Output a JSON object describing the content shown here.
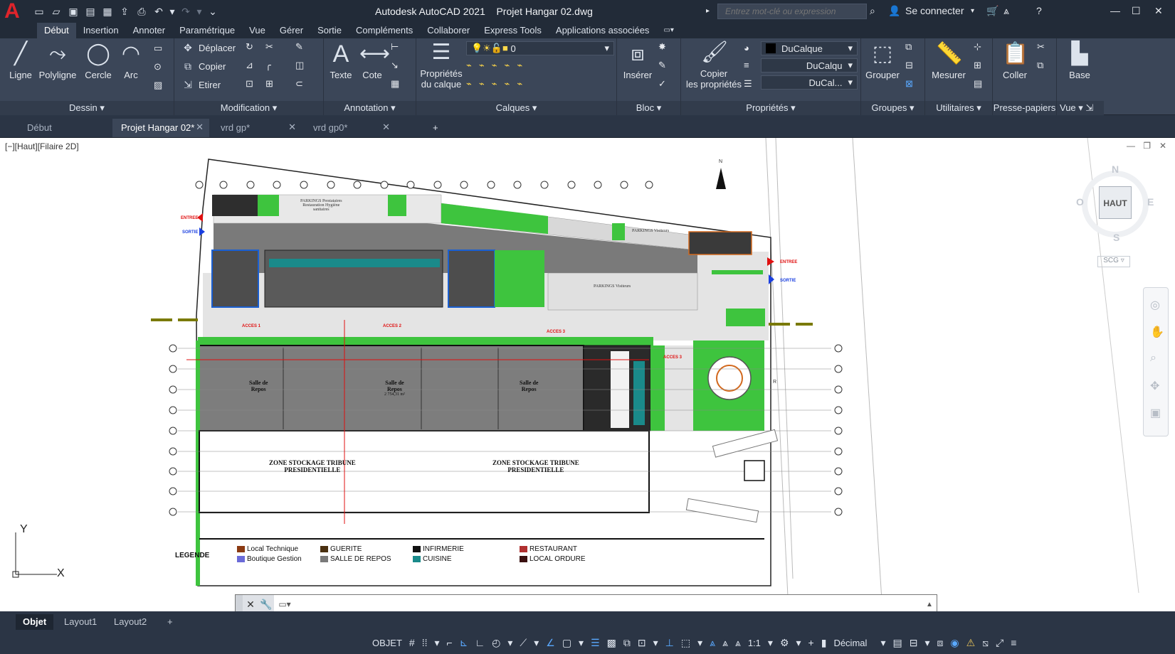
{
  "app": {
    "title": "Autodesk AutoCAD 2021",
    "file": "Projet Hangar 02.dwg",
    "search_placeholder": "Entrez mot-clé ou expression",
    "signin": "Se connecter",
    "logo_letter": "A"
  },
  "ribbon_tabs": [
    "Début",
    "Insertion",
    "Annoter",
    "Paramétrique",
    "Vue",
    "Gérer",
    "Sortie",
    "Compléments",
    "Collaborer",
    "Express Tools",
    "Applications associées"
  ],
  "ribbon": {
    "dessin": {
      "title": "Dessin",
      "ligne": "Ligne",
      "polyligne": "Polyligne",
      "cercle": "Cercle",
      "arc": "Arc"
    },
    "modification": {
      "title": "Modification",
      "deplacer": "Déplacer",
      "copier": "Copier",
      "etirer": "Etirer"
    },
    "annotation": {
      "title": "Annotation",
      "texte": "Texte",
      "cote": "Cote"
    },
    "calques": {
      "title": "Calques",
      "proprietes_l1": "Propriétés",
      "proprietes_l2": "du calque",
      "layer_value": "0"
    },
    "bloc": {
      "title": "Bloc",
      "inserer": "Insérer"
    },
    "proprietes": {
      "title": "Propriétés",
      "copier_l1": "Copier",
      "copier_l2": "les propriétés",
      "color": "DuCalque",
      "linetype": "DuCalqu",
      "lineweight": "DuCal..."
    },
    "groupes": {
      "title": "Groupes",
      "grouper": "Grouper"
    },
    "utilitaires": {
      "title": "Utilitaires",
      "mesurer": "Mesurer"
    },
    "pressepapiers": {
      "title": "Presse-papiers",
      "coller": "Coller"
    },
    "vue": {
      "title": "Vue",
      "base": "Base"
    }
  },
  "doc_tabs": [
    "Début",
    "Projet Hangar 02*",
    "vrd gp*",
    "vrd gp0*"
  ],
  "viewport": {
    "label": "[−][Haut][Filaire 2D]",
    "cube_top": "HAUT",
    "cube_n": "N",
    "cube_s": "S",
    "cube_e": "E",
    "cube_o": "O",
    "ucs": "SCG",
    "axis_x": "X",
    "axis_y": "Y"
  },
  "drawing": {
    "entree": "ENTREE",
    "sortie": "SORTIE",
    "parking1_l1": "PARKINGS Prestataires",
    "parking1_l2": "Restauration Hygiène",
    "parking1_l3": "sanitaires",
    "parking2": "PARKINGS Visiteurs",
    "parking3": "PARKINGS Visiteurs",
    "acces1": "ACCES 1",
    "acces2": "ACCES 2",
    "acces3": "ACCES 3",
    "acces4": "ACCES 3",
    "salle1_l1": "Salle de",
    "salle1_l2": "Repos",
    "salle2_l1": "Salle de",
    "salle2_l2": "Repos",
    "salle2_l3": "2 754,31 m²",
    "salle3_l1": "Salle de",
    "salle3_l2": "Repos",
    "zone1_l1": "ZONE STOCKAGE TRIBUNE",
    "zone1_l2": "PRESIDENTIELLE",
    "zone2_l1": "ZONE STOCKAGE TRIBUNE",
    "zone2_l2": "PRESIDENTIELLE",
    "north": "N",
    "rr": "R"
  },
  "legend": {
    "title": "LEGENDE",
    "items": [
      {
        "label": "Local Technique",
        "color": "#8b3a12"
      },
      {
        "label": "Boutique Gestion",
        "color": "#6b6bd8"
      },
      {
        "label": "GUERITE",
        "color": "#4a3010"
      },
      {
        "label": "SALLE DE REPOS",
        "color": "#7a7a7a"
      },
      {
        "label": "INFIRMERIE",
        "color": "#111111"
      },
      {
        "label": "CUISINE",
        "color": "#1a8a8a"
      },
      {
        "label": "RESTAURANT",
        "color": "#b03030"
      },
      {
        "label": "LOCAL ORDURE",
        "color": "#3a1010"
      }
    ]
  },
  "layout_tabs": [
    "Objet",
    "Layout1",
    "Layout2"
  ],
  "status": {
    "mode": "OBJET",
    "scale": "1:1",
    "units": "Décimal"
  }
}
